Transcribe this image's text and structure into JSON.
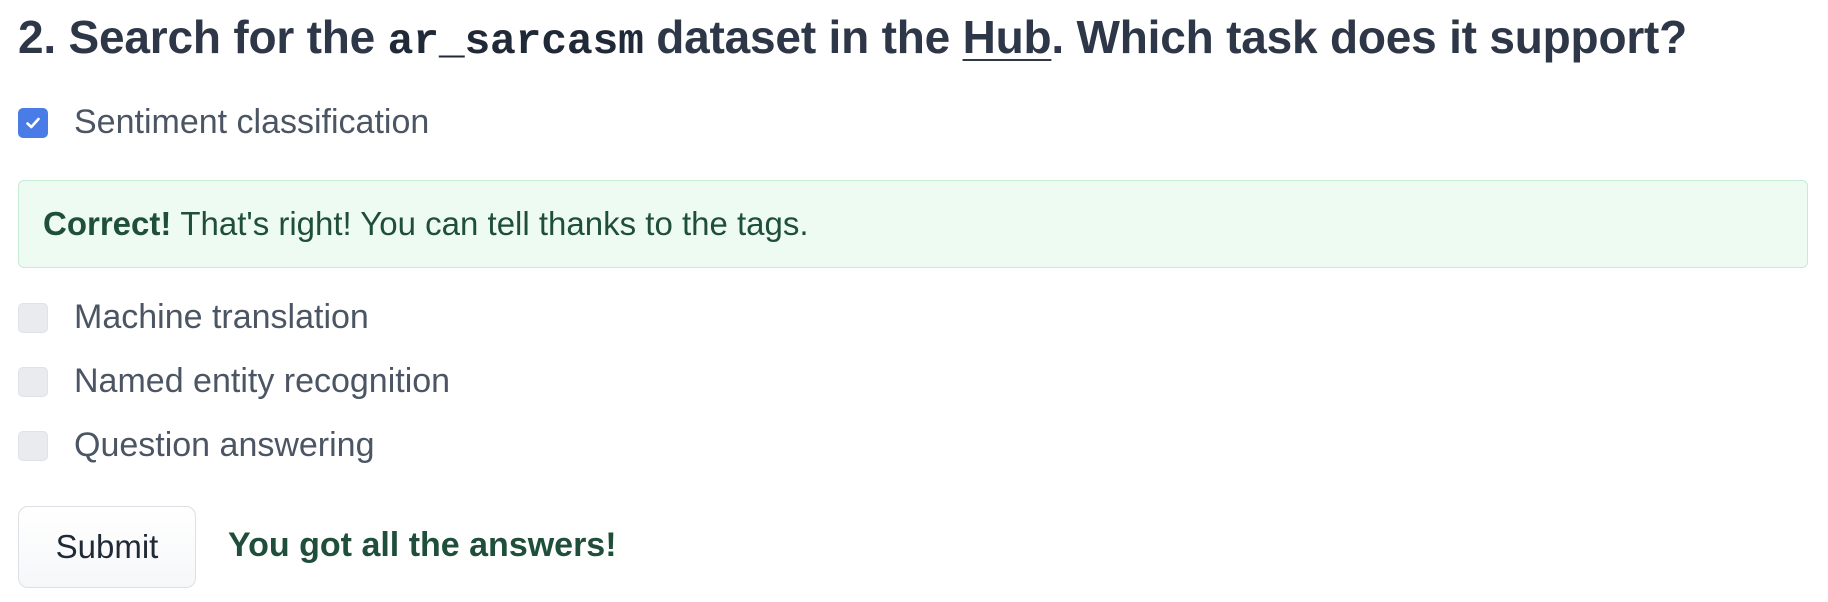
{
  "question": {
    "prefix": "2. Search for the ",
    "dataset_code": "ar_sarcasm",
    "middle": " dataset in the ",
    "hub_link": "Hub",
    "suffix": ". Which task does it support?"
  },
  "options": [
    {
      "label": "Sentiment classification",
      "checked": true
    },
    {
      "label": "Machine translation",
      "checked": false
    },
    {
      "label": "Named entity recognition",
      "checked": false
    },
    {
      "label": "Question answering",
      "checked": false
    }
  ],
  "feedback": {
    "status": "Correct!",
    "message": "That's right! You can tell thanks to the tags."
  },
  "submit_label": "Submit",
  "result_message": "You got all the answers!",
  "colors": {
    "checkbox_checked": "#4a7ce8",
    "feedback_background": "#eefbf3",
    "feedback_text": "#1f4f3a"
  },
  "icons": {
    "checked_box": "check-icon"
  }
}
